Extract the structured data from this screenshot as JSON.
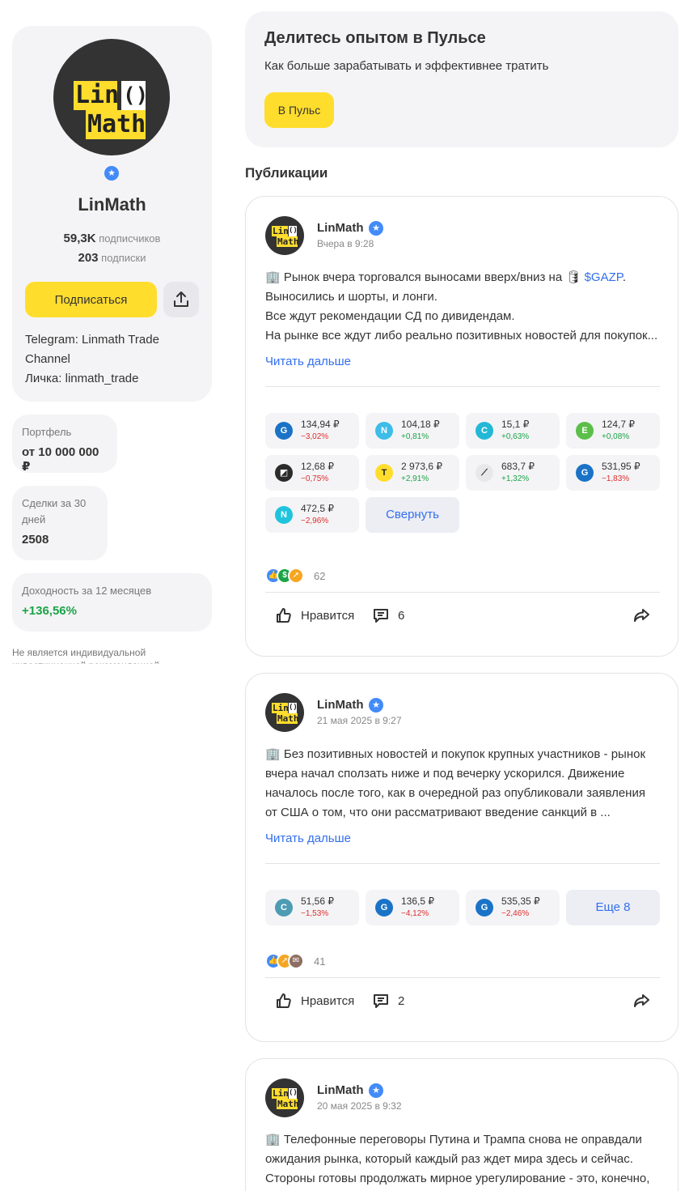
{
  "profile": {
    "logo_text_1": "Lin",
    "logo_text_2": "()",
    "logo_text_3": "Math",
    "name": "LinMath",
    "followers_count": "59,3K",
    "followers_label": "подписчиков",
    "following_count": "203",
    "following_label": "подписки",
    "subscribe_label": "Подписаться",
    "bio_lines": [
      "Telegram: Linmath Trade",
      "Channel",
      "Личка: linmath_trade"
    ]
  },
  "stats": {
    "portfolio_label": "Портфель",
    "portfolio_value": "от 10 000 000 ₽",
    "deals_label": "Сделки за 30 дней",
    "deals_value": "2508",
    "yield_label": "Доходность за 12 месяцев",
    "yield_value": "+136,56%"
  },
  "disclaimer": "Не является индивидуальной инвестиционной рекомендацией",
  "pulse": {
    "title": "Делитесь опытом в Пульсе",
    "subtitle": "Как больше зарабатывать и эффективнее тратить",
    "button_label": "В Пульс"
  },
  "publications_title": "Публикации",
  "colors": {
    "accent_yellow": "#ffdd2d",
    "link_blue": "#336fee",
    "negative": "#dd2e2e",
    "positive": "#1ba447",
    "verify": "#428bf9"
  },
  "posts": [
    {
      "author": "LinMath",
      "date": "Вчера в 9:28",
      "text_line1_pre": "🏢 Рынок вчера торговался выносами вверх/вниз на 🛢",
      "ticker": "$GAZP",
      "text_line1_post": ".",
      "text_lines": [
        "Выносились и шорты, и лонги.",
        "Все ждут рекомендации СД по дивидендам.",
        "На рынке все ждут либо реально позитивных новостей для покупок..."
      ],
      "read_more": "Читать дальше",
      "chips": [
        {
          "icon": "gazprom-icon",
          "glyph": "G",
          "color": "#1a73c7",
          "price": "134,94 ₽",
          "change": "−3,02%",
          "dir": "neg"
        },
        {
          "icon": "novatek-icon",
          "glyph": "N",
          "color": "#3dbde8",
          "price": "104,18 ₽",
          "change": "+0,81%",
          "dir": "pos"
        },
        {
          "icon": "sber-c-icon",
          "glyph": "C",
          "color": "#22b8d6",
          "price": "15,1 ₽",
          "change": "+0,63%",
          "dir": "pos"
        },
        {
          "icon": "e-icon",
          "glyph": "E",
          "color": "#5bbf4a",
          "price": "124,7 ₽",
          "change": "+0,08%",
          "dir": "pos"
        },
        {
          "icon": "square-logo-icon",
          "glyph": "◩",
          "color": "#2b2b2b",
          "price": "12,68 ₽",
          "change": "−0,75%",
          "dir": "neg"
        },
        {
          "icon": "tinkoff-icon",
          "glyph": "T",
          "color": "#ffdd2d",
          "price": "2 973,6 ₽",
          "change": "+2,91%",
          "dir": "pos"
        },
        {
          "icon": "tatneft-icon",
          "glyph": "⟋",
          "color": "#e8e8ea",
          "price": "683,7 ₽",
          "change": "+1,32%",
          "dir": "pos"
        },
        {
          "icon": "gazprom-neft-icon",
          "glyph": "G",
          "color": "#1a73c7",
          "price": "531,95 ₽",
          "change": "−1,83%",
          "dir": "neg"
        },
        {
          "icon": "n-icon",
          "glyph": "N",
          "color": "#1fc4dc",
          "price": "472,5 ₽",
          "change": "−2,96%",
          "dir": "neg"
        }
      ],
      "chip_action": "Свернуть",
      "reactions_count": "62",
      "like_label": "Нравится",
      "comments_count": "6"
    },
    {
      "author": "LinMath",
      "date": "21 мая 2025 в 9:27",
      "text_lines": [
        "🏢 Без позитивных новостей и покупок крупных участников - рынок",
        "вчера начал сползать ниже и под вечерку ускорился. Движение",
        "началось после того, как в очередной раз опубликовали заявления",
        "от США о том, что они рассматривают введение санкций в ..."
      ],
      "read_more": "Читать дальше",
      "chips": [
        {
          "icon": "c-icon",
          "glyph": "C",
          "color": "#4e9bb4",
          "price": "51,56 ₽",
          "change": "−1,53%",
          "dir": "neg"
        },
        {
          "icon": "gazprom-icon",
          "glyph": "G",
          "color": "#1a73c7",
          "price": "136,5 ₽",
          "change": "−4,12%",
          "dir": "neg"
        },
        {
          "icon": "gazprom-neft-icon",
          "glyph": "G",
          "color": "#1a73c7",
          "price": "535,35 ₽",
          "change": "−2,46%",
          "dir": "neg"
        }
      ],
      "chip_action": "Еще 8",
      "reactions_count": "41",
      "like_label": "Нравится",
      "comments_count": "2"
    },
    {
      "author": "LinMath",
      "date": "20 мая 2025 в 9:32",
      "text_lines": [
        "🏢 Телефонные переговоры Путина и Трампа снова не оправдали",
        "ожидания рынка, который каждый раз ждет мира здесь и сейчас.",
        "Стороны готовы продолжать мирное урегулирование - это, конечно,"
      ]
    }
  ]
}
